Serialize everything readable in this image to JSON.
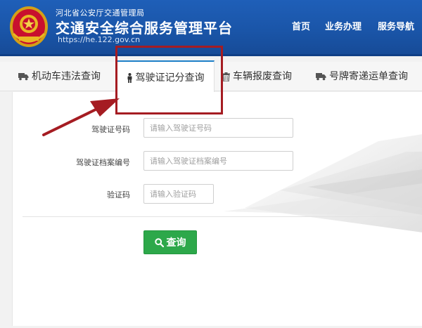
{
  "header": {
    "org_name": "河北省公安厅交通管理局",
    "title": "交通安全综合服务管理平台",
    "url": "https://he.122.gov.cn",
    "nav": [
      {
        "label": "首页"
      },
      {
        "label": "业务办理"
      },
      {
        "label": "服务导航"
      }
    ]
  },
  "tabs": [
    {
      "label": "机动车违法查询",
      "icon": "truck-icon"
    },
    {
      "label": "驾驶证记分查询",
      "icon": "person-icon",
      "active": true
    },
    {
      "label": "车辆报废查询",
      "icon": "trash-icon"
    },
    {
      "label": "号牌寄递运单查询",
      "icon": "truck-icon"
    }
  ],
  "form": {
    "license_number": {
      "label": "驾驶证号码",
      "placeholder": "请输入驾驶证号码",
      "value": ""
    },
    "file_number": {
      "label": "驾驶证档案编号",
      "placeholder": "请输入驾驶证档案编号",
      "value": ""
    },
    "captcha": {
      "label": "验证码",
      "placeholder": "请输入验证码",
      "value": ""
    },
    "submit_label": "查询"
  },
  "colors": {
    "header_blue": "#1a55a8",
    "active_tab_border": "#1e7fc8",
    "button_green": "#2da84a",
    "annotation_red": "#a51c22"
  }
}
